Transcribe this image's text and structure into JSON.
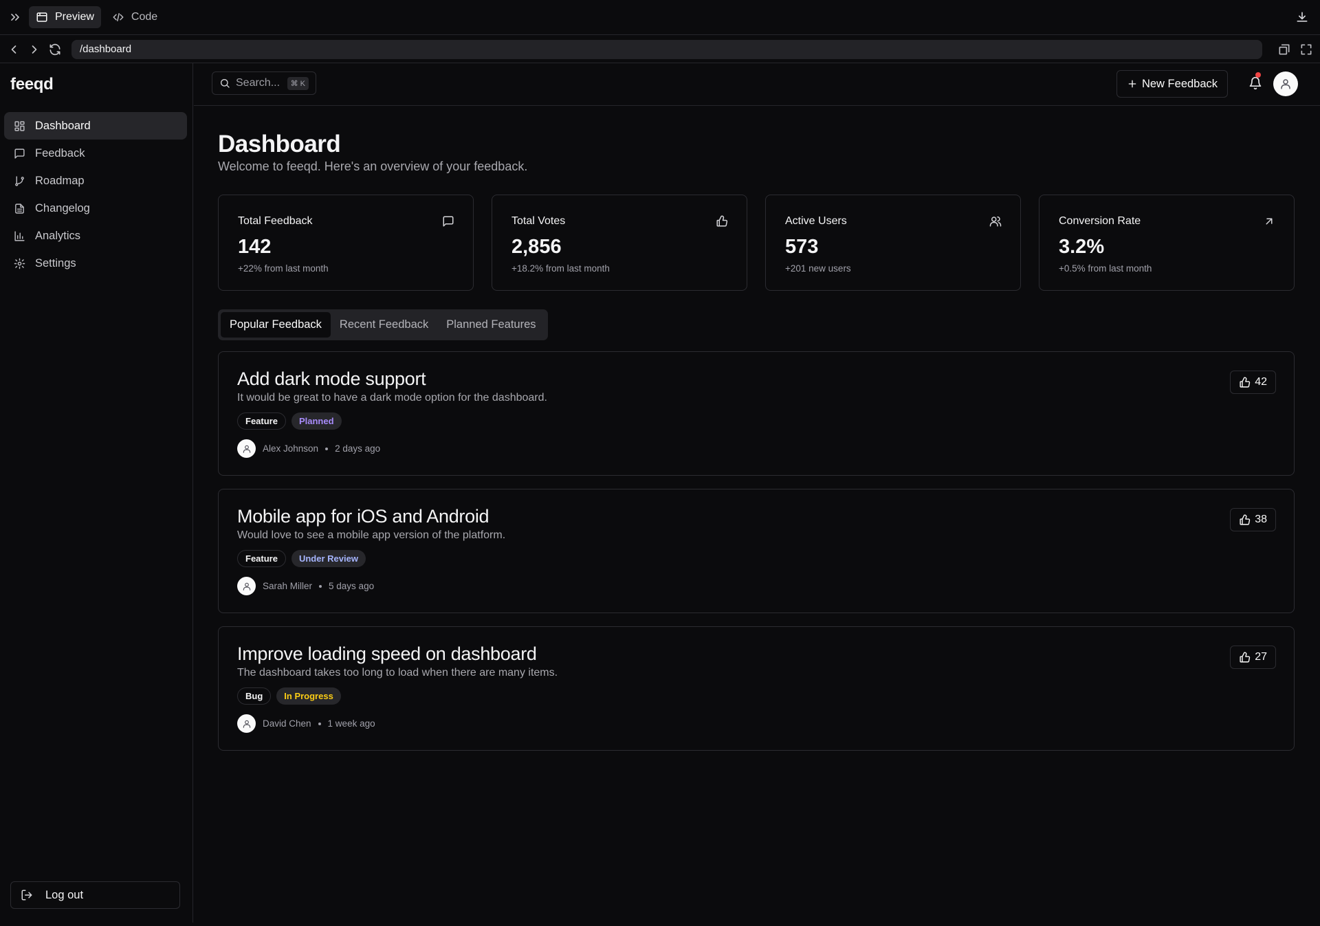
{
  "browser": {
    "mode_tabs": [
      {
        "label": "Preview",
        "icon": "window-icon",
        "active": true
      },
      {
        "label": "Code",
        "icon": "code-icon",
        "active": false
      }
    ],
    "url": "/dashboard"
  },
  "app": {
    "logo": "feeqd"
  },
  "sidebar": {
    "items": [
      {
        "label": "Dashboard",
        "icon": "grid-icon",
        "active": true
      },
      {
        "label": "Feedback",
        "icon": "message-icon",
        "active": false
      },
      {
        "label": "Roadmap",
        "icon": "branch-icon",
        "active": false
      },
      {
        "label": "Changelog",
        "icon": "document-icon",
        "active": false
      },
      {
        "label": "Analytics",
        "icon": "bar-chart-icon",
        "active": false
      },
      {
        "label": "Settings",
        "icon": "gear-icon",
        "active": false
      }
    ],
    "logout_label": "Log out"
  },
  "header": {
    "search_placeholder": "Search...",
    "search_shortcut": "⌘ K",
    "new_feedback_label": "New Feedback"
  },
  "page": {
    "title": "Dashboard",
    "subtitle": "Welcome to feeqd. Here's an overview of your feedback."
  },
  "stats": [
    {
      "label": "Total Feedback",
      "value": "142",
      "delta": "+22% from last month",
      "icon": "message-icon"
    },
    {
      "label": "Total Votes",
      "value": "2,856",
      "delta": "+18.2% from last month",
      "icon": "thumbs-up-icon"
    },
    {
      "label": "Active Users",
      "value": "573",
      "delta": "+201 new users",
      "icon": "users-icon"
    },
    {
      "label": "Conversion Rate",
      "value": "3.2%",
      "delta": "+0.5% from last month",
      "icon": "arrow-up-right-icon"
    }
  ],
  "tabs": [
    {
      "label": "Popular Feedback",
      "active": true
    },
    {
      "label": "Recent Feedback",
      "active": false
    },
    {
      "label": "Planned Features",
      "active": false
    }
  ],
  "feedback": [
    {
      "title": "Add dark mode support",
      "description": "It would be great to have a dark mode option for the dashboard.",
      "type": "Feature",
      "status": "Planned",
      "status_color": "#a78bfa",
      "author": "Alex Johnson",
      "time": "2 days ago",
      "votes": "42"
    },
    {
      "title": "Mobile app for iOS and Android",
      "description": "Would love to see a mobile app version of the platform.",
      "type": "Feature",
      "status": "Under Review",
      "status_color": "#a5b4fc",
      "author": "Sarah Miller",
      "time": "5 days ago",
      "votes": "38"
    },
    {
      "title": "Improve loading speed on dashboard",
      "description": "The dashboard takes too long to load when there are many items.",
      "type": "Bug",
      "status": "In Progress",
      "status_color": "#facc15",
      "author": "David Chen",
      "time": "1 week ago",
      "votes": "27"
    }
  ]
}
